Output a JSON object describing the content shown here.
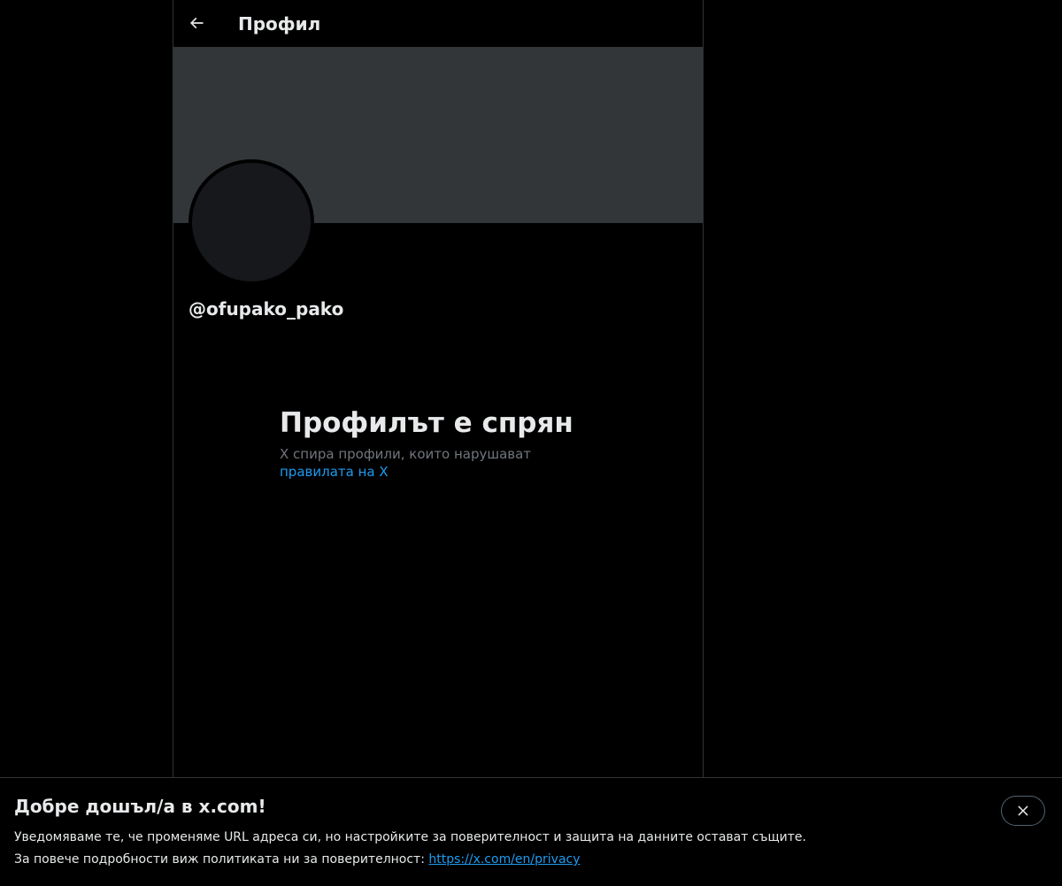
{
  "header": {
    "title": "Профил"
  },
  "profile": {
    "handle": "@ofupako_pako"
  },
  "suspended": {
    "title": "Профилът е спрян",
    "description": "X спира профили, които нарушават",
    "link_text": "правилата на X"
  },
  "notice": {
    "title": "Добре дошъл/а в x.com!",
    "line1": "Уведомяваме те, че променяме URL адреса си, но настройките за поверителност и защита на данните остават същите.",
    "line2_prefix": "За повече подробности виж политиката ни за поверителност: ",
    "privacy_link": "https://x.com/en/privacy"
  },
  "icons": {
    "back": "arrow-left-icon",
    "close": "close-icon"
  },
  "colors": {
    "background": "#000000",
    "banner": "#333639",
    "avatar": "#16181c",
    "link": "#1d9bf0",
    "muted_text": "#71767b",
    "border": "#2f3336"
  }
}
